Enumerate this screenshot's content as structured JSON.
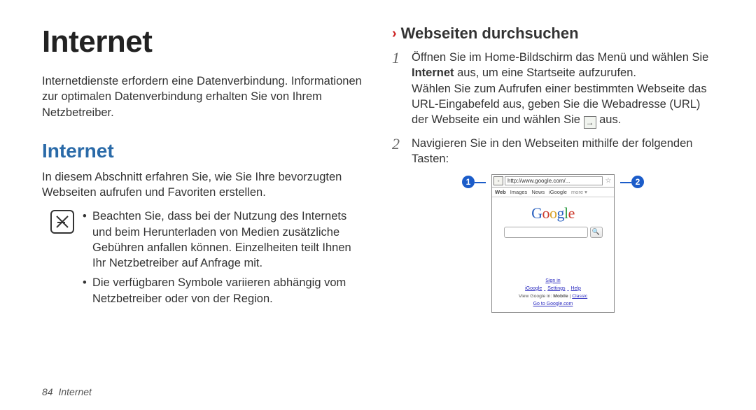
{
  "left": {
    "h1": "Internet",
    "intro": "Internetdienste erfordern eine Datenverbindung. Informationen zur optimalen Datenverbindung erhalten Sie von Ihrem Netzbetreiber.",
    "h2": "Internet",
    "section_intro": "In diesem Abschnitt erfahren Sie, wie Sie Ihre bevorzugten Webseiten aufrufen und Favoriten erstellen.",
    "notes": [
      "Beachten Sie, dass bei der Nutzung des Internets und beim Herunterladen von Medien zusätzliche Gebühren anfallen können. Einzelheiten teilt Ihnen Ihr Netzbetreiber auf Anfrage mit.",
      "Die verfügbaren Symbole variieren abhängig vom Netzbetreiber oder von der Region."
    ]
  },
  "right": {
    "section_title": "Webseiten durchsuchen",
    "steps": {
      "s1_num": "1",
      "s1_a": "Öffnen Sie im Home-Bildschirm das Menü und wählen Sie ",
      "s1_bold": "Internet",
      "s1_b": " aus, um eine Startseite aufzurufen.",
      "s1_c": "Wählen Sie zum Aufrufen einer bestimmten Webseite das URL-Eingabefeld aus, geben Sie die Webadresse (URL) der Webseite ein und wählen Sie ",
      "s1_d": " aus.",
      "s2_num": "2",
      "s2_text": "Navigieren Sie in den Webseiten mithilfe der folgenden Tasten:"
    },
    "callouts": {
      "c1": "1",
      "c2": "2"
    },
    "screen": {
      "url": "http://www.google.com/...",
      "tabs": {
        "web": "Web",
        "images": "Images",
        "news": "News",
        "igoogle": "iGoogle",
        "more": "more ▾"
      },
      "signin": "Sign in",
      "links": {
        "igoogle": "iGoogle",
        "settings": "Settings",
        "help": "Help"
      },
      "view_pre": "View Google in: ",
      "view_mobile": "Mobile",
      "view_sep": " | ",
      "view_classic": "Classic",
      "gotogoogle": "Go to Google.com"
    }
  },
  "footer": {
    "page": "84",
    "title": "Internet"
  }
}
